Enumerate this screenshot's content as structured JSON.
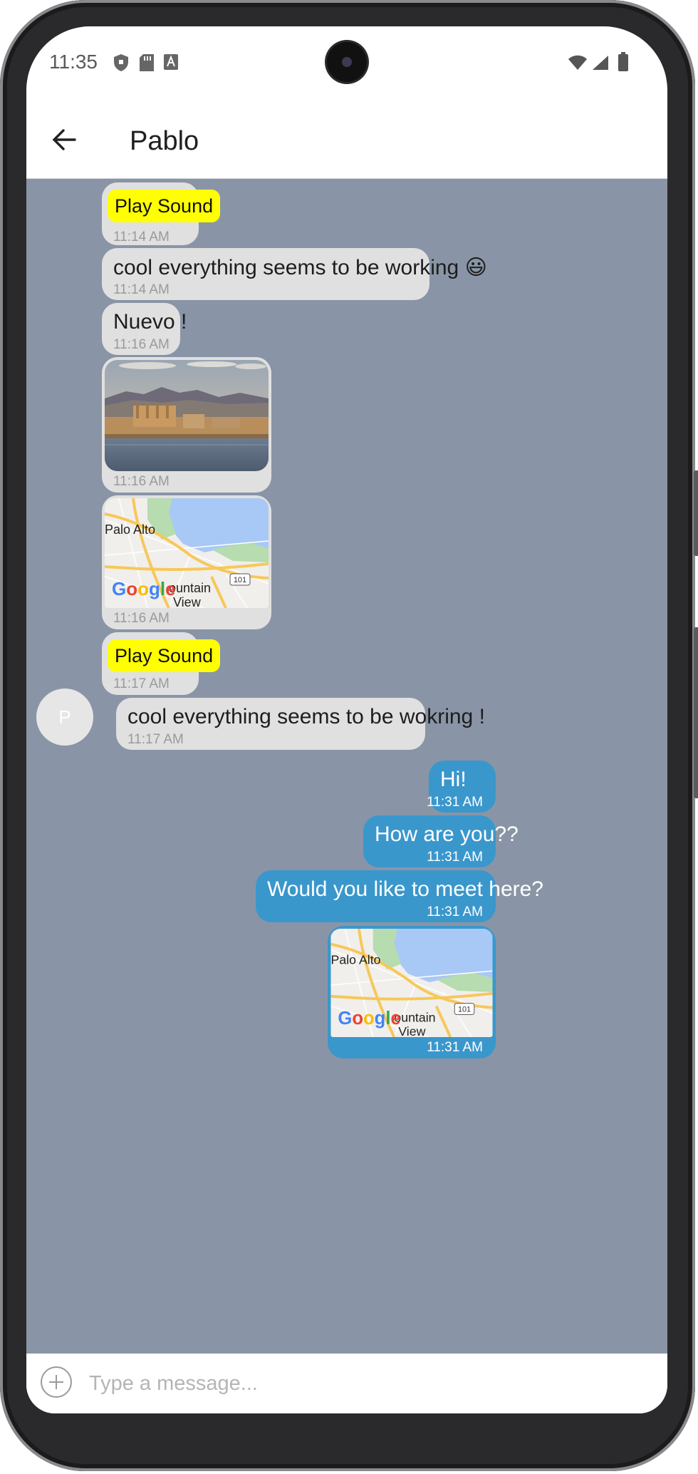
{
  "status_bar": {
    "time": "11:35"
  },
  "header": {
    "title": "Pablo"
  },
  "avatar": {
    "initial": "P"
  },
  "messages_in": [
    {
      "type": "sound",
      "label": "Play Sound",
      "time": "11:14 AM"
    },
    {
      "type": "text",
      "text": "cool everything seems to be working 😃",
      "time": "11:14 AM"
    },
    {
      "type": "text",
      "text": "Nuevo !",
      "time": "11:16 AM"
    },
    {
      "type": "image",
      "time": "11:16 AM"
    },
    {
      "type": "map",
      "time": "11:16 AM"
    },
    {
      "type": "sound",
      "label": "Play Sound",
      "time": "11:17 AM"
    },
    {
      "type": "text",
      "text": "cool everything seems to be wokring !",
      "time": "11:17 AM"
    }
  ],
  "messages_out": [
    {
      "type": "text",
      "text": "Hi!",
      "time": "11:31 AM"
    },
    {
      "type": "text",
      "text": "How are you??",
      "time": "11:31 AM"
    },
    {
      "type": "text",
      "text": "Would you like to meet here?",
      "time": "11:31 AM"
    },
    {
      "type": "map",
      "time": "11:31 AM"
    }
  ],
  "map_labels": {
    "city1": "Palo Alto",
    "city2_a": "ountain",
    "city2_b": "View",
    "highway": "101",
    "brand": "Google"
  },
  "composer": {
    "placeholder": "Type a message..."
  },
  "colors": {
    "chat_bg": "#8995a6",
    "incoming": "#e0e0e0",
    "outgoing": "#3a97cc",
    "sound_button": "#ffff00"
  }
}
